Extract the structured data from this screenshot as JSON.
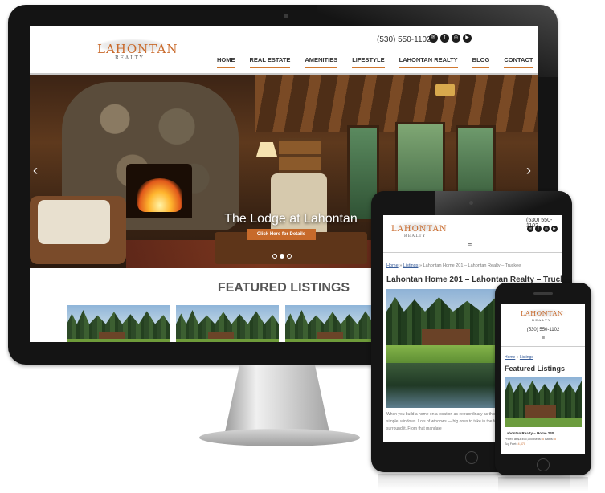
{
  "desktop": {
    "logo": {
      "main": "LAHONTAN",
      "sub": "REALTY"
    },
    "phone": "(530) 550-1102",
    "social": [
      {
        "icon": "email-icon",
        "glyph": "✉"
      },
      {
        "icon": "facebook-icon",
        "glyph": "f"
      },
      {
        "icon": "instagram-icon",
        "glyph": "◎"
      },
      {
        "icon": "youtube-icon",
        "glyph": "▶"
      }
    ],
    "nav": [
      "HOME",
      "REAL ESTATE",
      "AMENITIES",
      "LIFESTYLE",
      "LAHONTAN REALTY",
      "BLOG",
      "CONTACT"
    ],
    "hero": {
      "title": "The Lodge at Lahontan",
      "button": "Click Here for Details",
      "prev_arrow": "‹",
      "next_arrow": "›",
      "slide_count": 3,
      "active_slide": 2
    },
    "featured_title": "FEATURED LISTINGS"
  },
  "tablet": {
    "logo": {
      "main": "LAHONTAN",
      "sub": "REALTY"
    },
    "phone": "(530) 550-1102",
    "menu_glyph": "≡",
    "breadcrumb": {
      "home": "Home",
      "sep": " » ",
      "listings": "Listings",
      "current": "Lahontan Home 201 – Lahontan Realty – Truckee"
    },
    "title": "Lahontan Home 201 – Lahontan Realty – Truckee",
    "body": "When you build a home on a location as extraordinary as this one, the charge to your architect is simple: windows. Lots of windows — big ones to take in the forest, pond and fairway that surround it. From that mandate"
  },
  "phone": {
    "logo": {
      "main": "LAHONTAN",
      "sub": "REALTY"
    },
    "phone": "(530) 550-1102",
    "menu_glyph": "≡",
    "breadcrumb": {
      "home": "Home",
      "sep": " » ",
      "listings": "Listings"
    },
    "title": "Featured Listings",
    "card": {
      "title": "Lahontan Realty – Home 230",
      "price_label": "Priced at $3,495,000",
      "beds_label": "Beds:",
      "beds_value": "5",
      "baths_label": "Baths:",
      "baths_value": "5",
      "sqft_label": "Sq. Feet:",
      "sqft_value": "4,370"
    }
  },
  "colors": {
    "accent": "#c76a2b",
    "nav_underline": "#d0772e",
    "device_bezel": "#151515"
  }
}
